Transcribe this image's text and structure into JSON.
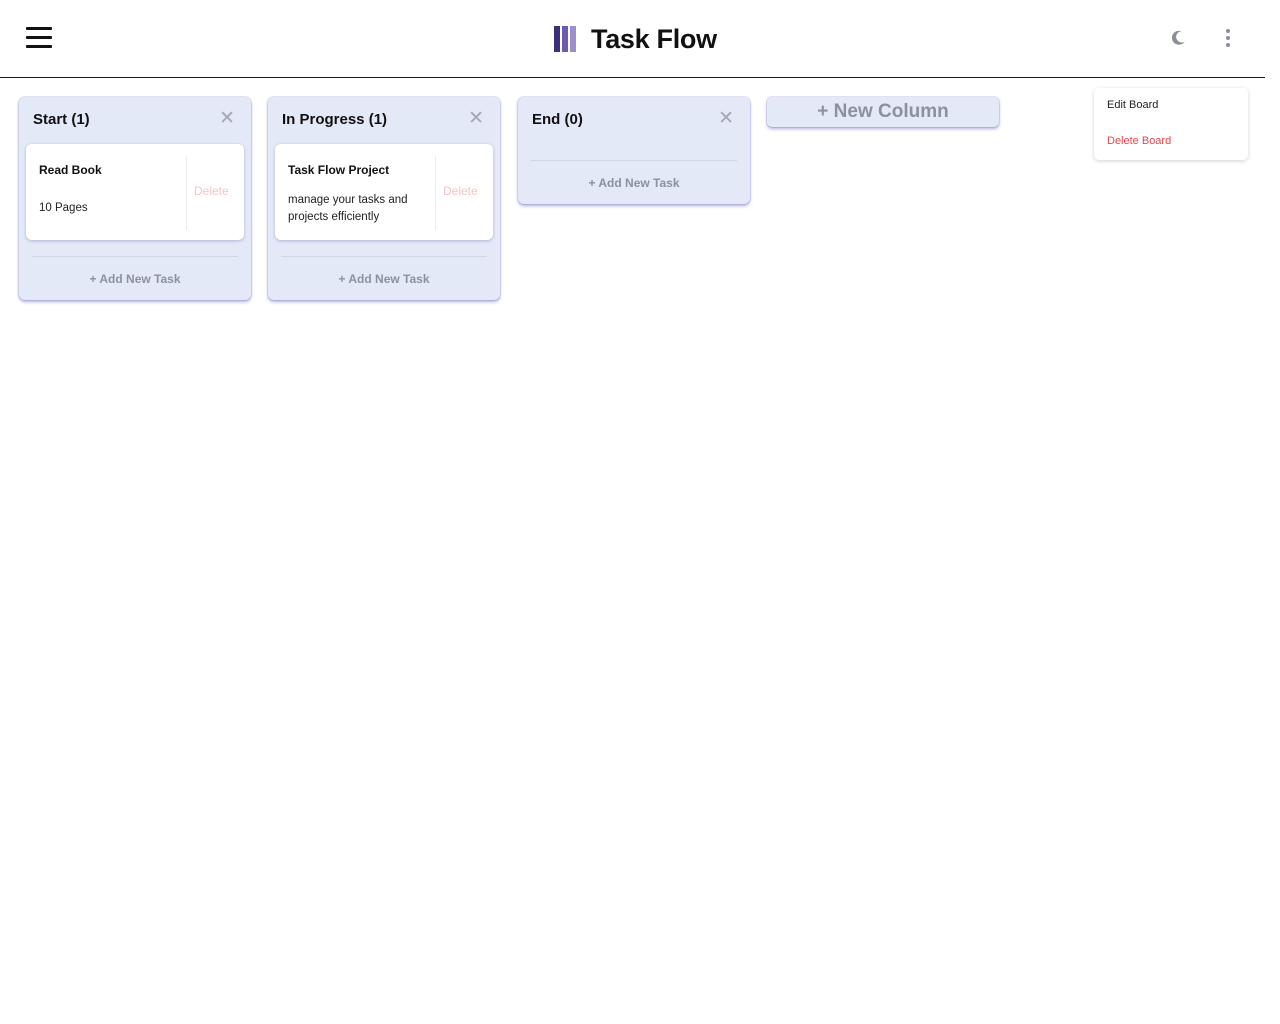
{
  "app": {
    "title": "Task Flow",
    "logo_colors": [
      "#3b2f7a",
      "#6b5bb0",
      "#9c8fd0"
    ]
  },
  "header": {
    "menu_icon": "hamburger-icon",
    "theme_icon": "moon-icon",
    "more_icon": "kebab-menu-icon"
  },
  "columns": [
    {
      "title": "Start (1)",
      "close": "✕",
      "tasks": [
        {
          "title": "Read Book",
          "description": "10 Pages",
          "delete_label": "Delete"
        }
      ],
      "add_task_label": "+ Add New Task"
    },
    {
      "title": "In Progress (1)",
      "close": "✕",
      "tasks": [
        {
          "title": "Task Flow Project",
          "description": "manage your tasks and projects efficiently",
          "delete_label": "Delete"
        }
      ],
      "add_task_label": "+ Add New Task"
    },
    {
      "title": "End (0)",
      "close": "✕",
      "tasks": [],
      "add_task_label": "+ Add New Task"
    }
  ],
  "new_column_label": "+ New Column",
  "board_menu": {
    "items": [
      {
        "label": "Edit Board",
        "color": "#222222"
      },
      {
        "label": "Delete Board",
        "color": "#e5484d"
      }
    ]
  }
}
